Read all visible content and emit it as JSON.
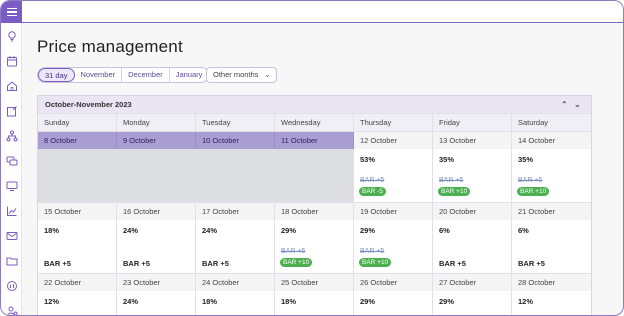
{
  "page": {
    "title": "Price management"
  },
  "tabs": [
    "31 day",
    "November",
    "December",
    "January"
  ],
  "other_months": "Other months",
  "calendar": {
    "title": "October-November 2023",
    "days": [
      "Sunday",
      "Monday",
      "Tuesday",
      "Wednesday",
      "Thursday",
      "Friday",
      "Saturday"
    ],
    "weeks": [
      {
        "cells": [
          {
            "date": "8 October",
            "past": true
          },
          {
            "date": "9 October",
            "past": true
          },
          {
            "date": "10 October",
            "past": true
          },
          {
            "date": "11 October",
            "past": true
          },
          {
            "date": "12 October",
            "pct": "53%",
            "bar_old": "BAR +5",
            "bar_new": "BAR -5"
          },
          {
            "date": "13 October",
            "pct": "35%",
            "bar_old": "BAR +5",
            "bar_new": "BAR +10"
          },
          {
            "date": "14 October",
            "pct": "35%",
            "bar_old": "BAR +5",
            "bar_new": "BAR +10"
          }
        ]
      },
      {
        "cells": [
          {
            "date": "15 October",
            "pct": "18%",
            "bar": "BAR +5"
          },
          {
            "date": "16 October",
            "pct": "24%",
            "bar": "BAR +5"
          },
          {
            "date": "17 October",
            "pct": "24%",
            "bar": "BAR +5"
          },
          {
            "date": "18 October",
            "pct": "29%",
            "bar_old": "BAR +5",
            "bar_new": "BAR +10"
          },
          {
            "date": "19 October",
            "pct": "29%",
            "bar_old": "BAR +5",
            "bar_new": "BAR +10"
          },
          {
            "date": "20 October",
            "pct": "6%",
            "bar": "BAR +5"
          },
          {
            "date": "21 October",
            "pct": "6%",
            "bar": "BAR +5"
          }
        ]
      },
      {
        "cells": [
          {
            "date": "22 October",
            "pct": "12%"
          },
          {
            "date": "23 October",
            "pct": "24%"
          },
          {
            "date": "24 October",
            "pct": "18%"
          },
          {
            "date": "25 October",
            "pct": "18%"
          },
          {
            "date": "26 October",
            "pct": "29%"
          },
          {
            "date": "27 October",
            "pct": "29%"
          },
          {
            "date": "28 October",
            "pct": "12%"
          }
        ]
      }
    ]
  },
  "sidebar_icons": [
    "lightbulb-icon",
    "calendar-icon",
    "home-icon",
    "edit-icon",
    "sitemap-icon",
    "chat-icon",
    "monitor-icon",
    "chart-icon",
    "mail-icon",
    "folder-icon",
    "analytics-icon",
    "settings-user-icon"
  ]
}
